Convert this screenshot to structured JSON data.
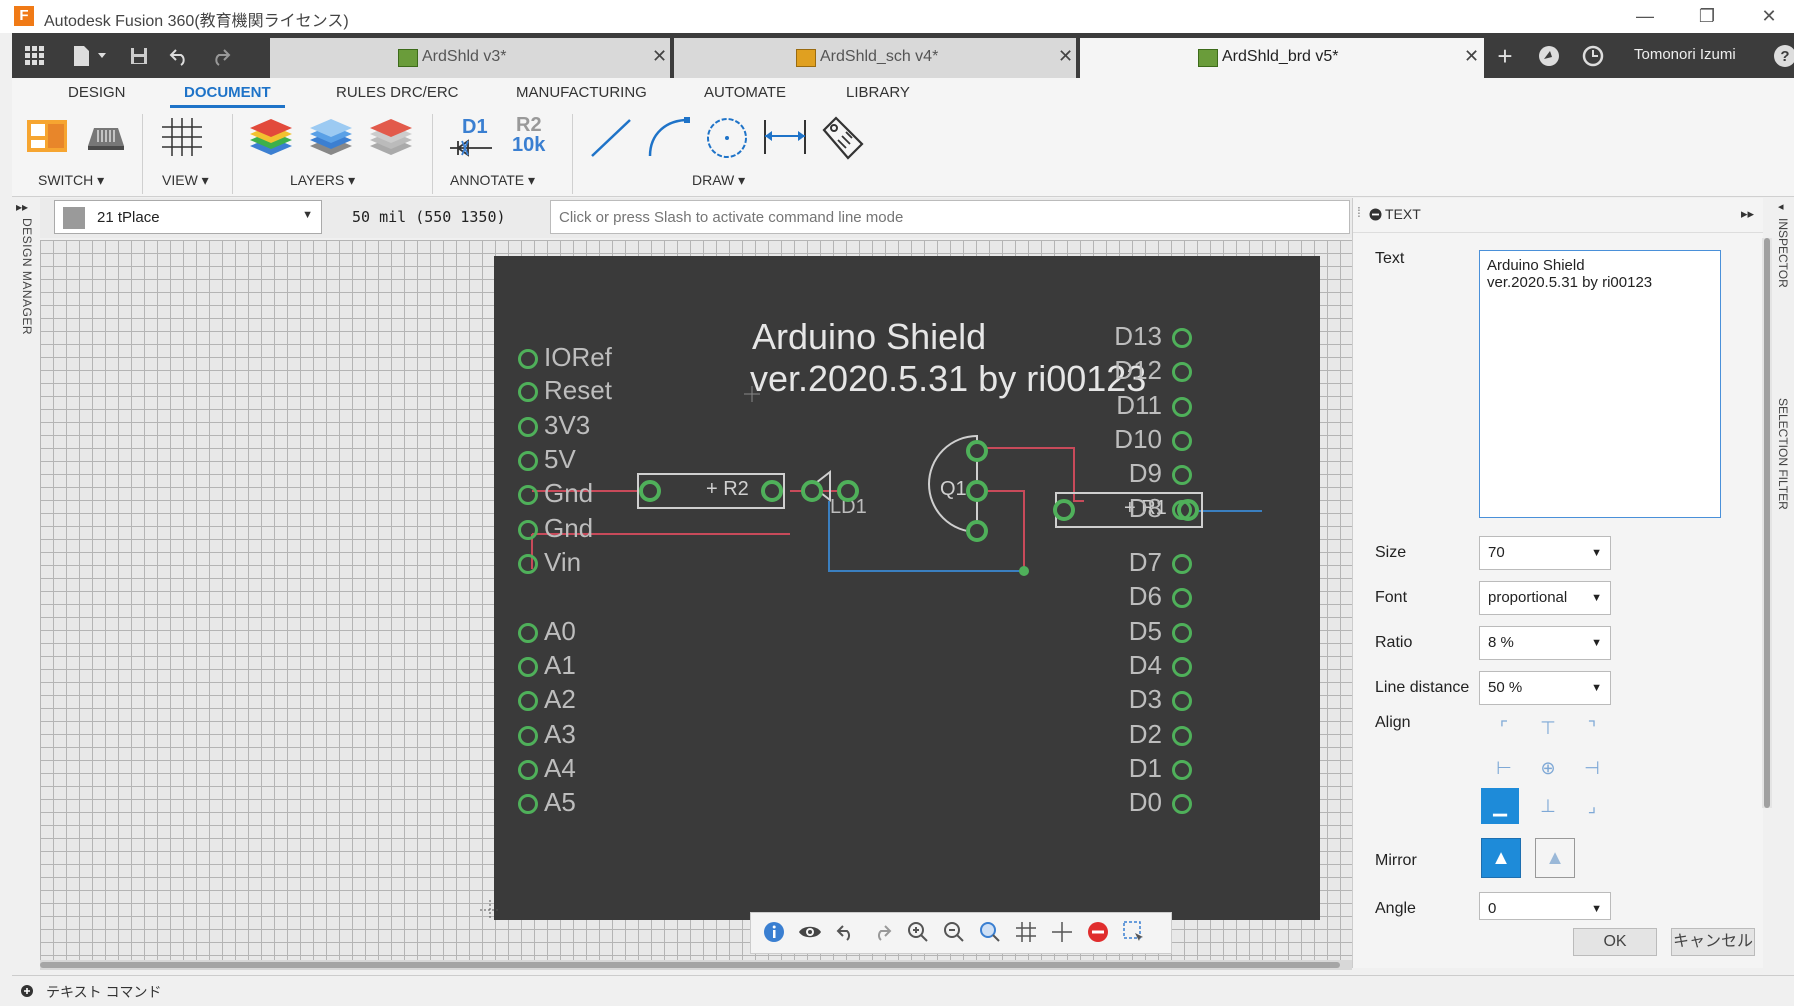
{
  "window": {
    "title": "Autodesk Fusion 360(教育機関ライセンス)",
    "min_glyph": "—",
    "restore_glyph": "❐",
    "close_glyph": "✕"
  },
  "doc_tabs": [
    {
      "label": "ArdShld v3*",
      "active": false
    },
    {
      "label": "ArdShld_sch v4*",
      "active": false
    },
    {
      "label": "ArdShld_brd v5*",
      "active": true
    }
  ],
  "tab_close_glyph": "✕",
  "user": {
    "name": "Tomonori Izumi"
  },
  "toolbar_icons": {
    "grid": "grid-icon",
    "file": "file-icon",
    "save": "save-icon",
    "undo": "undo-icon",
    "redo": "redo-icon",
    "new_tab": "plus-icon",
    "jobs": "job-status-icon",
    "clock": "clock-icon",
    "help": "help-icon"
  },
  "ribbon": {
    "tabs": [
      "DESIGN",
      "DOCUMENT",
      "RULES DRC/ERC",
      "MANUFACTURING",
      "AUTOMATE",
      "LIBRARY"
    ],
    "groups": [
      "SWITCH ▾",
      "VIEW ▾",
      "LAYERS ▾",
      "ANNOTATE ▾",
      "DRAW ▾"
    ],
    "annotate_d1": "D1",
    "annotate_r2": "R2",
    "annotate_10k": "10k"
  },
  "left_panel": {
    "label": "DESIGN MANAGER",
    "expand": "▸▸"
  },
  "command": {
    "layer": "21 tPlace",
    "coords": "50 mil (550 1350)",
    "placeholder": "Click or press Slash to activate command line mode"
  },
  "board": {
    "title_line1": "Arduino Shield",
    "title_line2": "ver.2020.5.31 by ri00123",
    "left_pins": [
      "IORef",
      "Reset",
      "3V3",
      "5V",
      "Gnd",
      "Gnd",
      "Vin",
      "A0",
      "A1",
      "A2",
      "A3",
      "A4",
      "A5"
    ],
    "right_pins": [
      "D13",
      "D12",
      "D11",
      "D10",
      "D9",
      "D8",
      "D7",
      "D6",
      "D5",
      "D4",
      "D3",
      "D2",
      "D1",
      "D0"
    ],
    "parts": {
      "r2": "+ R2",
      "r1": "+ R1",
      "led": "LD1",
      "q1": "Q1"
    }
  },
  "status": {
    "text": "テキスト コマンド"
  },
  "panel": {
    "title": "TEXT",
    "collapse": "▸▸",
    "text_label": "Text",
    "text_value": "Arduino Shield\nver.2020.5.31 by ri00123",
    "size_label": "Size",
    "size_value": "70",
    "font_label": "Font",
    "font_value": "proportional",
    "ratio_label": "Ratio",
    "ratio_value": "8 %",
    "line_label": "Line distance",
    "line_value": "50 %",
    "align_label": "Align",
    "mirror_label": "Mirror",
    "angle_label": "Angle",
    "angle_value": "0",
    "ok": "OK",
    "cancel": "キャンセル"
  },
  "side_labels": {
    "inspector": "INSPECTOR",
    "selection": "SELECTION FILTER"
  },
  "colors": {
    "accent": "#1e8bd9",
    "board": "#3a3a3a",
    "pad": "#4fb05a",
    "trace_red": "#c84a5a",
    "trace_blue": "#3a7fc0"
  }
}
